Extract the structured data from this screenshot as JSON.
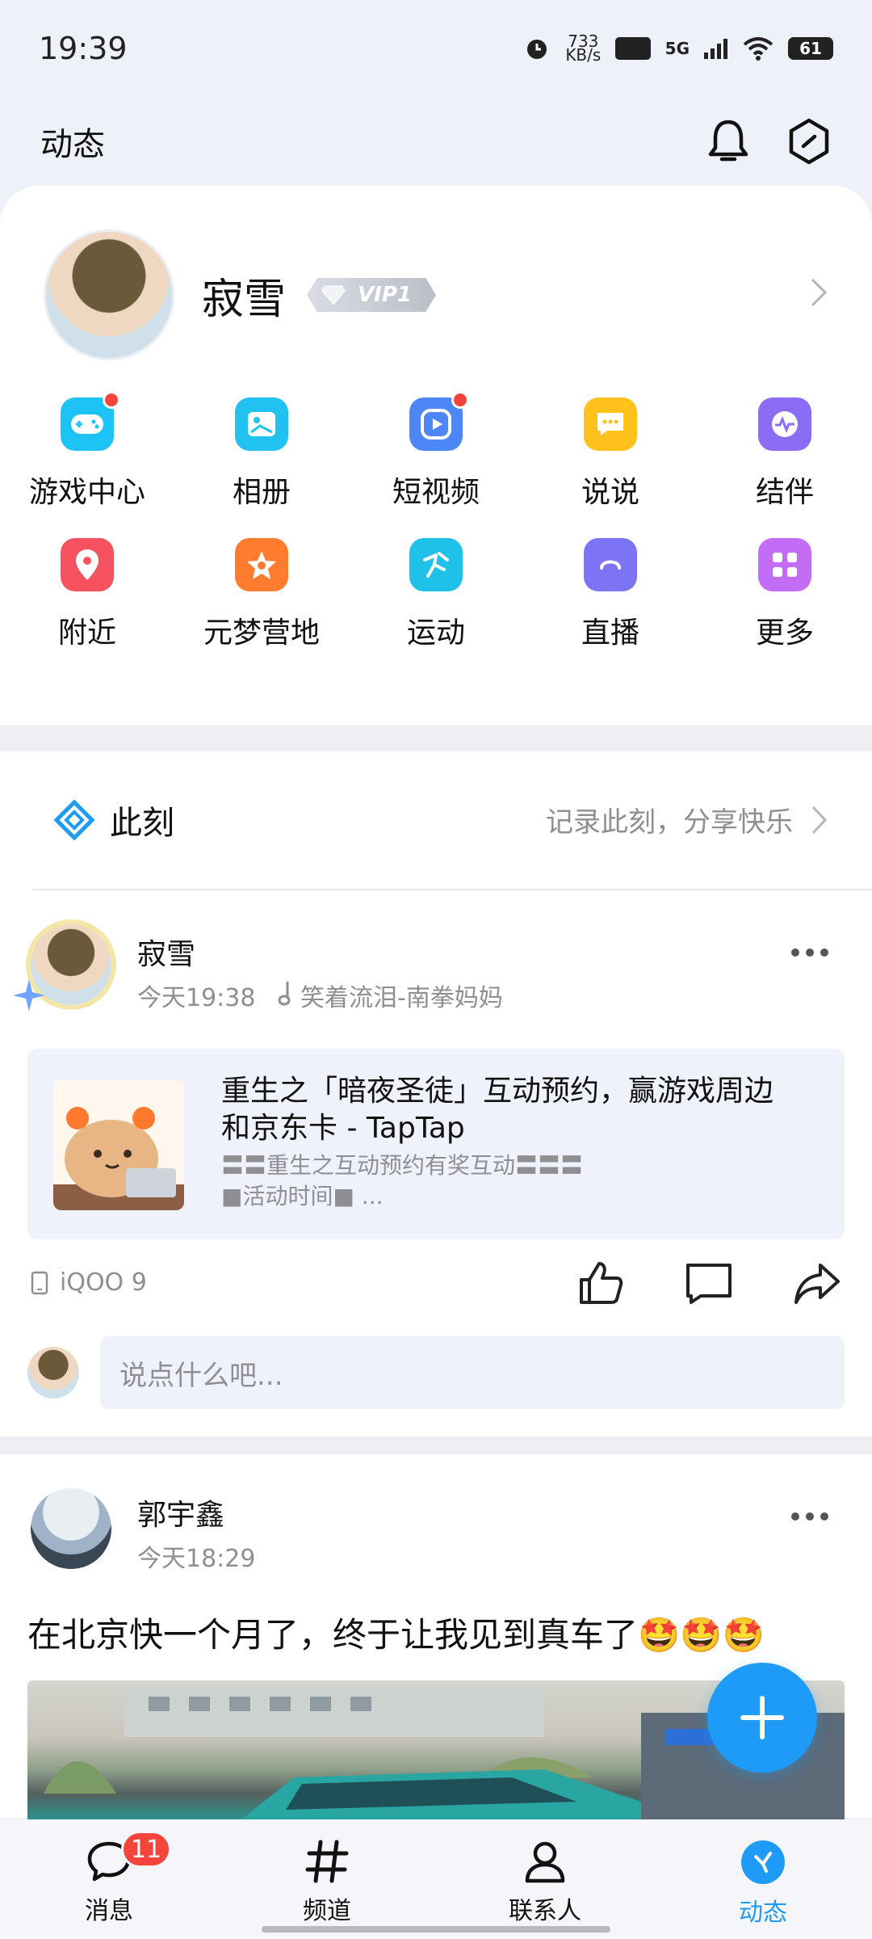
{
  "status_bar": {
    "time": "19:39",
    "net_speed_value": "733",
    "net_speed_unit": "KB/s",
    "hd": "HD",
    "network": "5G",
    "battery": "61"
  },
  "header": {
    "title": "动态"
  },
  "profile": {
    "name": "寂雪",
    "vip": "VIP1"
  },
  "features": [
    {
      "label": "游戏中心",
      "icon": "gamepad-icon",
      "color": "#1ec3f5",
      "dot": true
    },
    {
      "label": "相册",
      "icon": "album-icon",
      "color": "#22c2f0",
      "dot": false
    },
    {
      "label": "短视频",
      "icon": "video-icon",
      "color": "#4d86f7",
      "dot": true
    },
    {
      "label": "说说",
      "icon": "chat-icon",
      "color": "#ffc21c",
      "dot": false
    },
    {
      "label": "结伴",
      "icon": "pulse-icon",
      "color": "#8b6cf5",
      "dot": false
    },
    {
      "label": "附近",
      "icon": "location-icon",
      "color": "#f5515f",
      "dot": false
    },
    {
      "label": "元梦营地",
      "icon": "star-icon",
      "color": "#ff7b2d",
      "dot": false
    },
    {
      "label": "运动",
      "icon": "run-icon",
      "color": "#1fc1e9",
      "dot": false
    },
    {
      "label": "直播",
      "icon": "live-icon",
      "color": "#7d73f5",
      "dot": false
    },
    {
      "label": "更多",
      "icon": "grid-icon",
      "color": "#c36cf5",
      "dot": false
    }
  ],
  "moment": {
    "title": "此刻",
    "hint": "记录此刻，分享快乐"
  },
  "post1": {
    "author": "寂雪",
    "time": "今天19:38",
    "music": "笑着流泪-南拳妈妈",
    "link_title": "重生之「暗夜圣徒」互动预约，赢游戏周边和京东卡 - TapTap",
    "link_desc_line1": "〓〓重生之互动预约有奖互动〓〓〓",
    "link_desc_line2": "■活动时间■ ...",
    "device": "iQOO 9",
    "comment_placeholder": "说点什么吧..."
  },
  "post2": {
    "author": "郭宇鑫",
    "time": "今天18:29",
    "text": "在北京快一个月了，终于让我见到真车了🤩🤩🤩"
  },
  "bottom_nav": [
    {
      "label": "消息",
      "badge": "11",
      "active": false
    },
    {
      "label": "频道",
      "active": false
    },
    {
      "label": "联系人",
      "active": false
    },
    {
      "label": "动态",
      "active": true
    }
  ],
  "colors": {
    "accent": "#1d9bf7",
    "badge_red": "#f5443b"
  }
}
